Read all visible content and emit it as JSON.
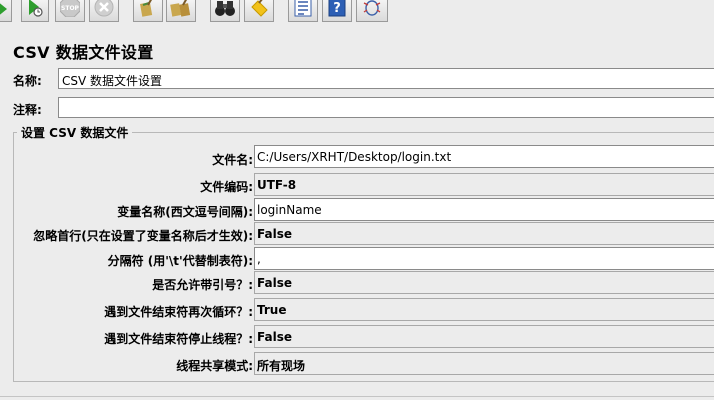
{
  "toolbar": {
    "buttons": [
      {
        "name": "start-button",
        "icon": "play-icon"
      },
      {
        "name": "start-no-timers-button",
        "icon": "play-no-timers-icon"
      },
      {
        "name": "stop-button",
        "icon": "stop-icon",
        "label": "STOP"
      },
      {
        "name": "shutdown-button",
        "icon": "shutdown-icon"
      },
      {
        "name": "clear-button",
        "icon": "broom-icon"
      },
      {
        "name": "clear-all-button",
        "icon": "broom-all-icon"
      },
      {
        "name": "search-button",
        "icon": "binoculars-icon"
      },
      {
        "name": "reset-search-button",
        "icon": "broom-yellow-icon"
      },
      {
        "name": "function-helper-button",
        "icon": "list-icon"
      },
      {
        "name": "help-button",
        "icon": "help-icon",
        "label": "?"
      },
      {
        "name": "debug-button",
        "icon": "bug-icon"
      }
    ]
  },
  "panel": {
    "title": "CSV 数据文件设置",
    "name_label": "名称:",
    "name_value": "CSV 数据文件设置",
    "comment_label": "注释:",
    "comment_value": ""
  },
  "group": {
    "title": "设置 CSV 数据文件",
    "fields": [
      {
        "label": "文件名:",
        "value": "C:/Users/XRHT/Desktop/login.txt",
        "editable": true
      },
      {
        "label": "文件编码:",
        "value": "UTF-8",
        "editable": false
      },
      {
        "label": "变量名称(西文逗号间隔):",
        "value": "loginName",
        "editable": true
      },
      {
        "label": "忽略首行(只在设置了变量名称后才生效):",
        "value": "False",
        "editable": false
      },
      {
        "label": "分隔符 (用'\\t'代替制表符):",
        "value": ",",
        "editable": true
      },
      {
        "label": "是否允许带引号？:",
        "value": "False",
        "editable": false
      },
      {
        "label": "遇到文件结束符再次循环？:",
        "value": "True",
        "editable": false
      },
      {
        "label": "遇到文件结束符停止线程？:",
        "value": "False",
        "editable": false
      },
      {
        "label": "线程共享模式:",
        "value": "所有现场",
        "editable": false
      }
    ]
  }
}
